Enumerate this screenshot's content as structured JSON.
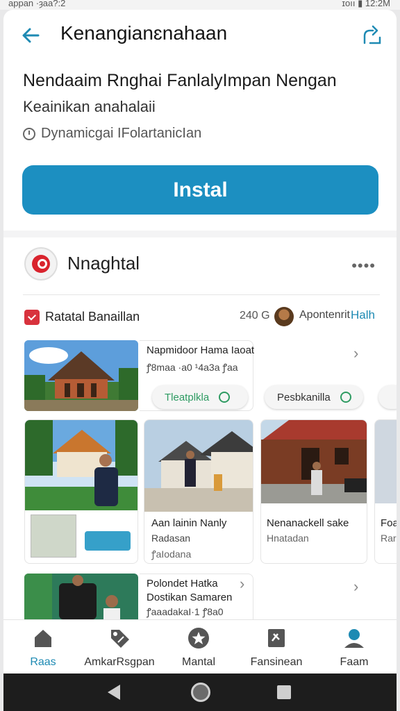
{
  "status_bar": {
    "left": "appan ·ȝaa?:2",
    "right": "ɪoıı ▮ 12:2M"
  },
  "app_bar": {
    "title": "Kenangianɛnahaan",
    "back_icon": "arrow-left-icon",
    "share_icon": "share-icon"
  },
  "listing": {
    "headline": "Nendaaim Rnghai FanlalyImpan Nengan",
    "subline": "Keainikan anahalaii",
    "meta": "Dynamicgai IFolartanicIan"
  },
  "install_button": {
    "label": "Instal",
    "color": "#1c8fc1"
  },
  "developer": {
    "name": "Nnaghtal",
    "logo_icon": "developer-logo-icon",
    "more_icon": "more-horizontal-icon"
  },
  "info_row": {
    "label": "Ratatal Banaillan",
    "size": "240 G",
    "author": "Apontenrit",
    "link": "Halh"
  },
  "featured": {
    "title": "Napmidoor Hama Iaoat",
    "subtitle": "ꝭ8maa ·a0 ¹4a3a ꝭaa",
    "pills": [
      {
        "label": "Tleatplkla"
      },
      {
        "label": "Pesbkanilla"
      }
    ]
  },
  "gallery": [
    {
      "title": "Aan lainin Nanly",
      "sub1": "Radasan",
      "sub2": "ꝭaIodana"
    },
    {
      "title": "Nenanackell sake",
      "sub1": "Hnatadan",
      "sub2": ""
    },
    {
      "title": "Foa",
      "sub1": "Rar",
      "sub2": ""
    }
  ],
  "second_item": {
    "title": "Polondet Hatka",
    "subtitle": "Dostikan Samaren",
    "meta": "ꝭaaadakaI·1 ꝭ8a0"
  },
  "bottom_nav": [
    {
      "label": "Raas",
      "icon": "home-icon"
    },
    {
      "label": "AmkarRsgpan",
      "icon": "tag-icon"
    },
    {
      "label": "Mantal",
      "icon": "star-icon"
    },
    {
      "label": "Fansinean",
      "icon": "book-icon"
    },
    {
      "label": "Faam",
      "icon": "person-icon"
    }
  ],
  "colors": {
    "accent": "#1e8ab3",
    "install": "#1c8fc1",
    "badge": "#d8323d"
  }
}
